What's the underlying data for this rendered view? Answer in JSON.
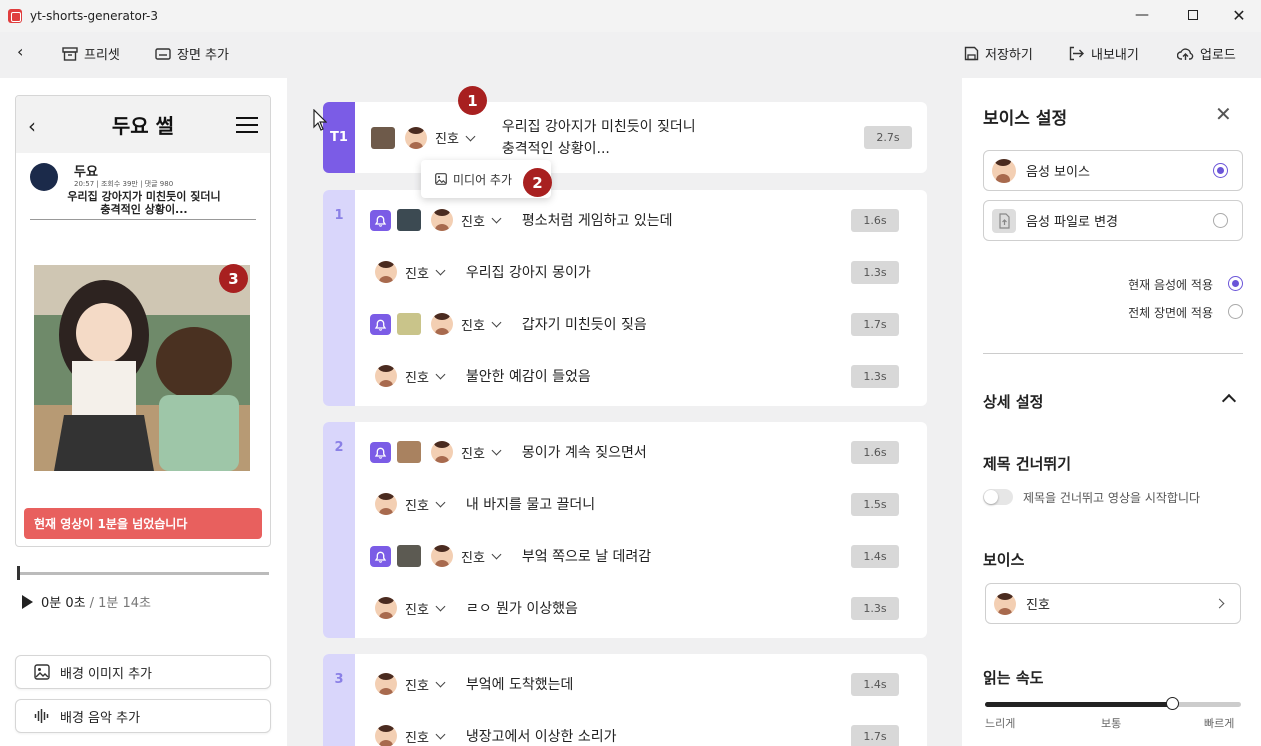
{
  "window": {
    "title": "yt-shorts-generator-3"
  },
  "toolbar": {
    "preset": "프리셋",
    "add_scene": "장면 추가",
    "save": "저장하기",
    "export": "내보내기",
    "upload": "업로드"
  },
  "preview": {
    "header_title": "두요 썰",
    "author": "두요",
    "meta": "20:57  |  조회수 39만  |  댓글 980",
    "post_title_line1": "우리집 강아지가 미친듯이 짖더니",
    "post_title_line2": "충격적인 상황이...",
    "alert": "현재 영상이 1분을 넘었습니다",
    "time_current": "0분 0초",
    "time_total": "/ 1분 14초",
    "playback_progress": 0
  },
  "left_buttons": {
    "add_bg_image": "배경 이미지 추가",
    "add_bg_music": "배경 음악 추가"
  },
  "scenes": [
    {
      "tab": "T1",
      "lines": [
        {
          "voice": "진호",
          "text_line1": "우리집 강아지가 미친듯이 짖더니",
          "text_line2": "충격적인 상황이...",
          "duration": "2.7s"
        }
      ]
    },
    {
      "tab": "1",
      "lines": [
        {
          "voice": "진호",
          "text": "평소처럼 게임하고 있는데",
          "duration": "1.6s",
          "has_media": true
        },
        {
          "voice": "진호",
          "text": "우리집 강아지 몽이가",
          "duration": "1.3s",
          "has_media": false
        },
        {
          "voice": "진호",
          "text": "갑자기 미친듯이 짖음",
          "duration": "1.7s",
          "has_media": true
        },
        {
          "voice": "진호",
          "text": "불안한 예감이 들었음",
          "duration": "1.3s",
          "has_media": false
        }
      ]
    },
    {
      "tab": "2",
      "lines": [
        {
          "voice": "진호",
          "text": "몽이가 계속 짖으면서",
          "duration": "1.6s",
          "has_media": true
        },
        {
          "voice": "진호",
          "text": "내 바지를 물고 끌더니",
          "duration": "1.5s",
          "has_media": false
        },
        {
          "voice": "진호",
          "text": "부엌 쪽으로 날 데려감",
          "duration": "1.4s",
          "has_media": true
        },
        {
          "voice": "진호",
          "text": "ㄹㅇ 뭔가 이상했음",
          "duration": "1.3s",
          "has_media": false
        }
      ]
    },
    {
      "tab": "3",
      "lines": [
        {
          "voice": "진호",
          "text": "부엌에 도착했는데",
          "duration": "1.4s",
          "has_media": false
        },
        {
          "voice": "진호",
          "text": "냉장고에서 이상한 소리가",
          "duration": "1.7s",
          "has_media": false
        }
      ]
    }
  ],
  "popup": {
    "add_media": "미디어 추가"
  },
  "badges": [
    "1",
    "2",
    "3"
  ],
  "voice_panel": {
    "title": "보이스 설정",
    "option_voice": "음성 보이스",
    "option_file": "음성 파일로 변경",
    "apply_current": "현재 음성에 적용",
    "apply_all": "전체 장면에 적용",
    "detail_title": "상세 설정",
    "skip_title_heading": "제목 건너뛰기",
    "skip_title_desc": "제목을 건너뛰고 영상을 시작합니다",
    "voice_heading": "보이스",
    "voice_selected": "진호",
    "speed_heading": "읽는 속도",
    "speed_slow": "느리게",
    "speed_normal": "보통",
    "speed_fast": "빠르게",
    "speed_value": 0.73
  },
  "colors": {
    "accent": "#7b5ce6",
    "tab_light": "#d9d6fb",
    "alert": "#e8605e",
    "badge": "#a82020"
  }
}
